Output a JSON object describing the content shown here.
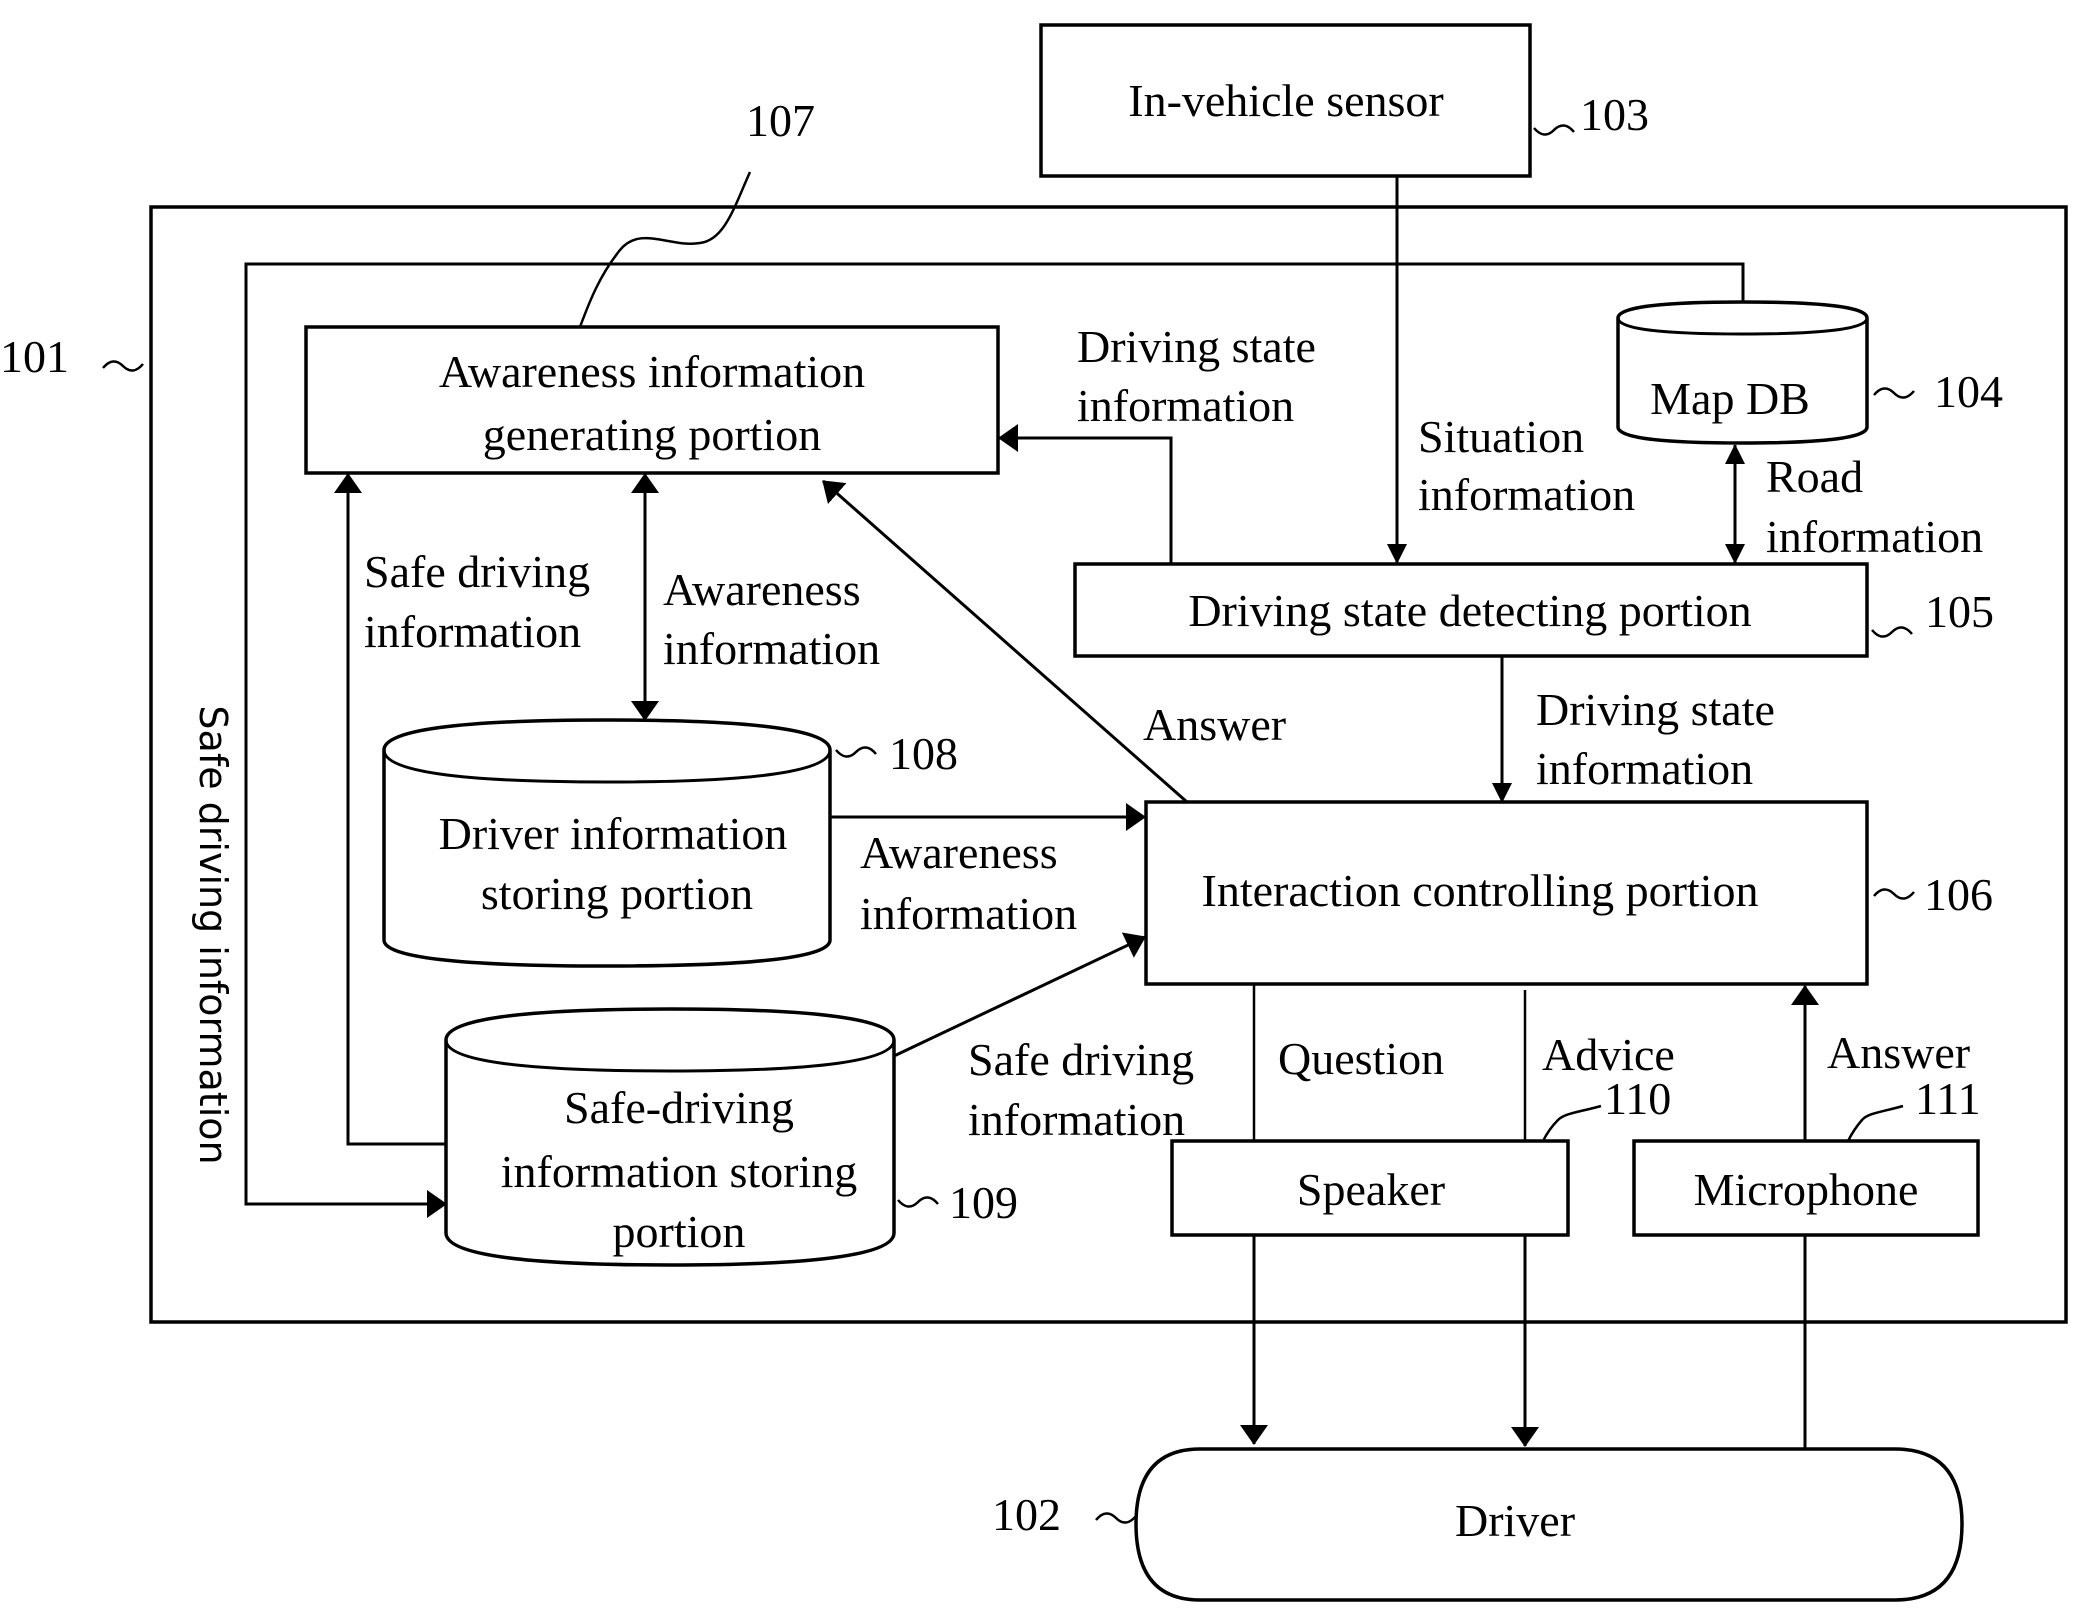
{
  "figure": {
    "system": {
      "ref": "101"
    },
    "driver": {
      "ref": "102",
      "label": "Driver"
    },
    "in_vehicle_sensor": {
      "ref": "103",
      "label": "In-vehicle sensor"
    },
    "map_db": {
      "ref": "104",
      "label": "Map DB"
    },
    "driving_state_detecting": {
      "ref": "105",
      "label": "Driving state detecting portion"
    },
    "interaction_controlling": {
      "ref": "106",
      "label": "Interaction controlling portion"
    },
    "awareness_generating": {
      "ref": "107",
      "lines": [
        "Awareness information",
        "generating portion"
      ]
    },
    "driver_info_storing": {
      "ref": "108",
      "lines": [
        "Driver information",
        "storing portion"
      ]
    },
    "safe_driving_storing": {
      "ref": "109",
      "lines": [
        "Safe-driving",
        "information storing",
        "portion"
      ]
    },
    "speaker": {
      "ref": "110",
      "label": "Speaker"
    },
    "microphone": {
      "ref": "111",
      "label": "Microphone"
    }
  },
  "flows": {
    "driving_state_to_awareness": [
      "Driving state",
      "information"
    ],
    "situation": [
      "Situation",
      "information"
    ],
    "road": [
      "Road",
      "information"
    ],
    "safe_driving_up": [
      "Safe driving",
      "information"
    ],
    "awareness_bidirectional": [
      "Awareness",
      "information"
    ],
    "answer_to_awareness": "Answer",
    "driving_state_to_interaction": [
      "Driving state",
      "information"
    ],
    "awareness_to_interaction": [
      "Awareness",
      "information"
    ],
    "safe_driving_to_interaction": [
      "Safe driving",
      "information"
    ],
    "question": "Question",
    "advice": "Advice",
    "answer_from_mic": "Answer",
    "safe_driving_loop": "Safe driving information"
  }
}
